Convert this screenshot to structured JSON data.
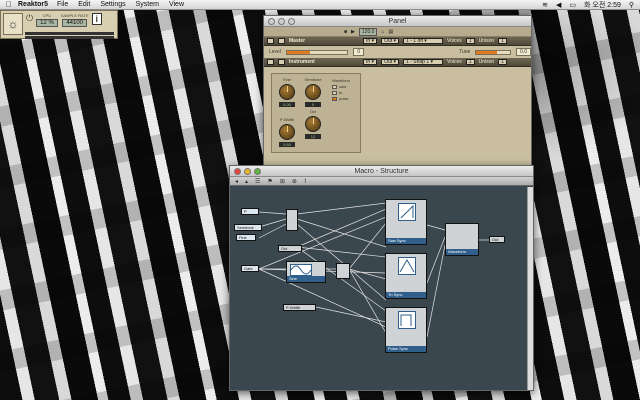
{
  "menubar": {
    "app": "Reaktor5",
    "items": [
      "File",
      "Edit",
      "Settings",
      "System",
      "View"
    ],
    "clock": "화 오전 2:59"
  },
  "toolbar": {
    "cpu_label": "CPU",
    "cpu": "12 %",
    "rate_label": "SAMPLE RATE",
    "rate": "44100",
    "audio_in": "audio in",
    "audio_out": "audio out"
  },
  "panel": {
    "title": "Panel",
    "bpm": "120.0",
    "master": {
      "name": "Master",
      "in": "In ▾",
      "out": "Out ▾",
      "preset": "1 - 1 off ▾",
      "voices_label": "Voices",
      "voices": "1",
      "unison_label": "Unison",
      "unison": "1",
      "level_label": "Level",
      "level_value": "0",
      "tune_label": "Tune",
      "tune_value": "0.0",
      "level_fill": 0.38,
      "tune_fill": 0.6
    },
    "instrument": {
      "name": "Instrument",
      "in": "In ▾",
      "out": "Out ▾",
      "preset": "1 - Snap 1 ▾",
      "voices_label": "Voices",
      "voices": "1",
      "unison_label": "Unison",
      "unison": "1",
      "knobs": [
        {
          "label": "Fine",
          "value": "0.00"
        },
        {
          "label": "Semitone",
          "value": "0"
        },
        {
          "label": "P-Width",
          "value": "0.50"
        },
        {
          "label": "Oct",
          "value": "12"
        }
      ],
      "waveform_label": "Waveform",
      "waveforms": [
        "saw",
        "tri",
        "pulse"
      ],
      "waveform_selected": "pulse"
    }
  },
  "structure": {
    "title": "Macro - Structure",
    "terminals": [
      "P",
      "Semitone",
      "Fine",
      "Oct",
      "P-Width",
      "Out",
      "Gate"
    ],
    "nodes": [
      "Saw Sync",
      "Tri Sync",
      "Pulse Sync",
      "Sine",
      "Waveform"
    ],
    "ports": {
      "osc_in": [
        "P",
        "F",
        "A",
        "Snc",
        "Ph",
        "Out"
      ],
      "sel": [
        "Saw",
        "Tri",
        "Pulse"
      ],
      "out": "Out"
    }
  }
}
